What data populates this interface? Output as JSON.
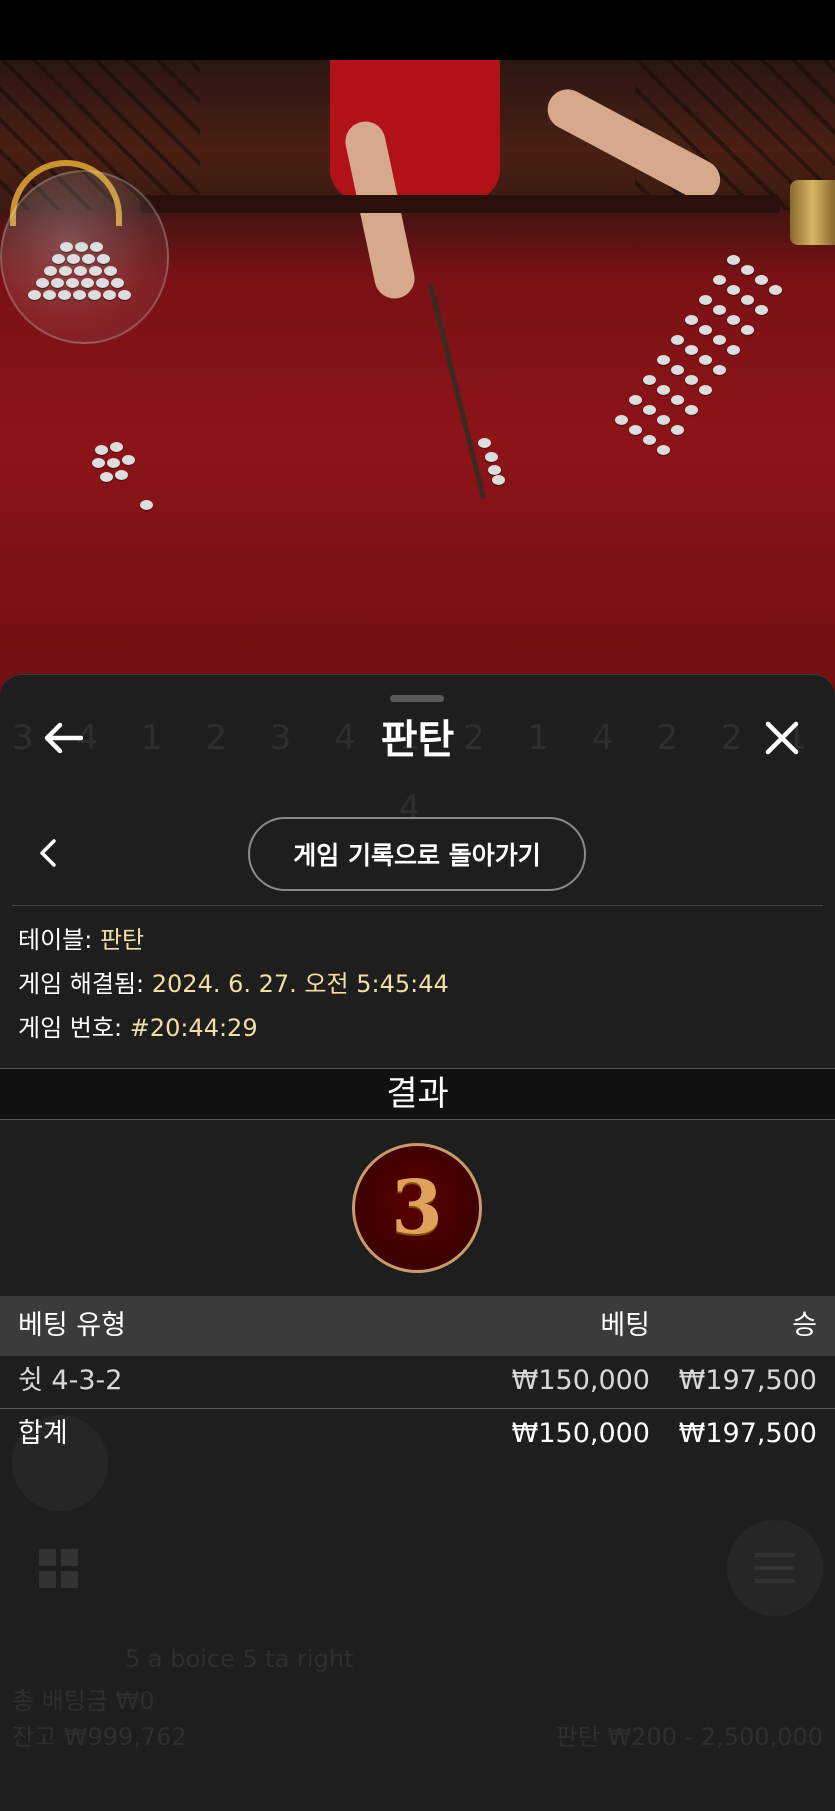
{
  "header": {
    "title": "판탄",
    "back_icon": "arrow-left-icon",
    "close_icon": "close-icon"
  },
  "navigation": {
    "prev_icon": "chevron-left-icon",
    "return_label": "게임 기록으로 돌아가기"
  },
  "info": {
    "table_label": "테이블:",
    "table_value": "판탄",
    "resolved_label": "게임 해결됨:",
    "resolved_value": "2024. 6. 27. 오전 5:45:44",
    "number_label": "게임 번호:",
    "number_value": "#20:44:29"
  },
  "results": {
    "heading": "결과",
    "value": "3"
  },
  "bets_table": {
    "columns": [
      "베팅 유형",
      "베팅",
      "승"
    ],
    "rows": [
      {
        "type": "쉿 4-3-2",
        "bet": "₩150,000",
        "win": "₩197,500"
      }
    ],
    "total": {
      "label": "합계",
      "bet": "₩150,000",
      "win": "₩197,500"
    }
  },
  "background_ghost": {
    "digits": "3 4 1 2 3 4 1 2 1 4 2 2 1 4",
    "line1": "5 a boice 5 ta right",
    "line2": "총 배팅금 ₩0",
    "line3": "잔고 ₩999,762",
    "line4": "판탄 ₩200 - 2,500,000"
  },
  "colors": {
    "sheet_bg": "#1e1e1e",
    "value_text": "#f2dfa6",
    "table_header_bg": "#3b3b3b",
    "result_circle": "#3d0000",
    "result_digit": "#e0a25a"
  }
}
